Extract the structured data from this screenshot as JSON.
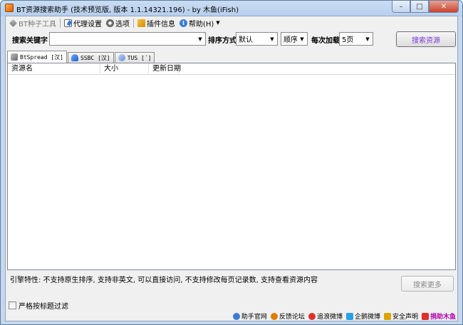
{
  "window": {
    "title": "BT资源搜索助手 (技术预览版, 版本 1.1.14321.196) - by 木鱼(iFish)",
    "min_symbol": "–",
    "max_symbol": "□",
    "close_symbol": "✕"
  },
  "toolbar": {
    "items": [
      {
        "label": "BT种子工具",
        "icon": "wrench-icon",
        "enabled": false
      },
      {
        "label": "代理设置",
        "icon": "proxy-icon",
        "enabled": true
      },
      {
        "label": "选项",
        "icon": "gear-icon",
        "enabled": true
      },
      {
        "label": "插件信息",
        "icon": "plugin-icon",
        "enabled": true
      },
      {
        "label": "帮助(H)",
        "icon": "help-icon",
        "enabled": true
      }
    ],
    "help_icon_glyph": "i",
    "dropdown_arrow": "▼"
  },
  "search": {
    "keyword_label": "搜索关键字",
    "keyword_value": "",
    "sort_label": "排序方式",
    "sort_value": "默认",
    "order_value": "顺序",
    "load_label": "每次加载",
    "load_value": "5页",
    "search_button": "搜索资源"
  },
  "tabs": [
    {
      "label": "BtSpread [汉]",
      "icon": "bt-icon",
      "active": true
    },
    {
      "label": "SSBC [汉]",
      "icon": "ssbc-icon",
      "active": false
    },
    {
      "label": "TUS [´]",
      "icon": "tus-icon",
      "active": false
    }
  ],
  "list": {
    "columns": [
      "资源名",
      "大小",
      "更新日期"
    ],
    "rows": []
  },
  "engine_info": "引擎特性: 不支持原生排序, 支持非英文, 可以直接访问, 不支持修改每页记录数, 支持查看资源内容",
  "more_button": "搜索更多",
  "filter_label": "严格按标题过滤",
  "footer_links": [
    {
      "label": "助手官网",
      "icon": "globe-icon",
      "color": "#3a7bd5"
    },
    {
      "label": "反馈论坛",
      "icon": "forum-icon",
      "color": "#e07b00"
    },
    {
      "label": "追浪微博",
      "icon": "weibo-icon",
      "color": "#e0302a"
    },
    {
      "label": "企鹅微博",
      "icon": "qq-weibo-icon",
      "color": "#2aa0e0"
    },
    {
      "label": "安全声明",
      "icon": "shield-icon",
      "color": "#d9a400"
    },
    {
      "label": "捐助木鱼",
      "icon": "donate-icon",
      "color": "#e0302a",
      "bold": true,
      "text_color": "#b000b0"
    }
  ]
}
